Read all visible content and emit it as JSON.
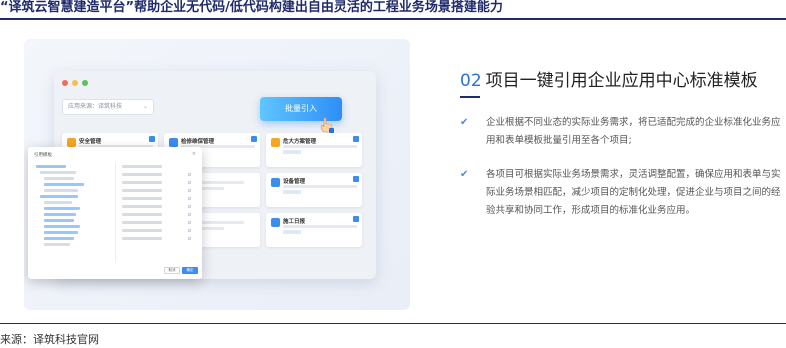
{
  "report": {
    "title": "“译筑云智慧建造平台”帮助企业无代码/低代码构建出自由灵活的工程业务场景搭建能力",
    "source_note": "来源：译筑科技官网"
  },
  "mockup": {
    "source_select": "应用来源：译筑科技",
    "batch_button": "批量引入",
    "cards": [
      {
        "name": "安全管理",
        "icon_color": "#f5a623",
        "checked": true
      },
      {
        "name": "检修维保管理",
        "icon_color": "#3b8df0",
        "checked": true
      },
      {
        "name": "危大方案管理",
        "icon_color": "#f5a623",
        "checked": true
      },
      {
        "name": "设备管理",
        "icon_color": "#3b8df0",
        "checked": true
      },
      {
        "name": "施工日报",
        "icon_color": "#3b8df0",
        "checked": true
      }
    ],
    "dialog": {
      "title": "引用模板",
      "cancel": "取消",
      "ok": "确定"
    }
  },
  "section": {
    "number": "02",
    "title": "项目一键引用企业应用中心标准模板",
    "bullets": [
      "企业根据不同业态的实际业务需求，将已适配完成的企业标准化业务应用和表单模板批量引用至各个项目;",
      "各项目可根据实际业务场景需求，灵活调整配置，确保应用和表单与实际业务场景相匹配，减少项目的定制化处理，促进企业与项目之间的经验共享和协同工作，形成项目的标准化业务应用。"
    ]
  }
}
